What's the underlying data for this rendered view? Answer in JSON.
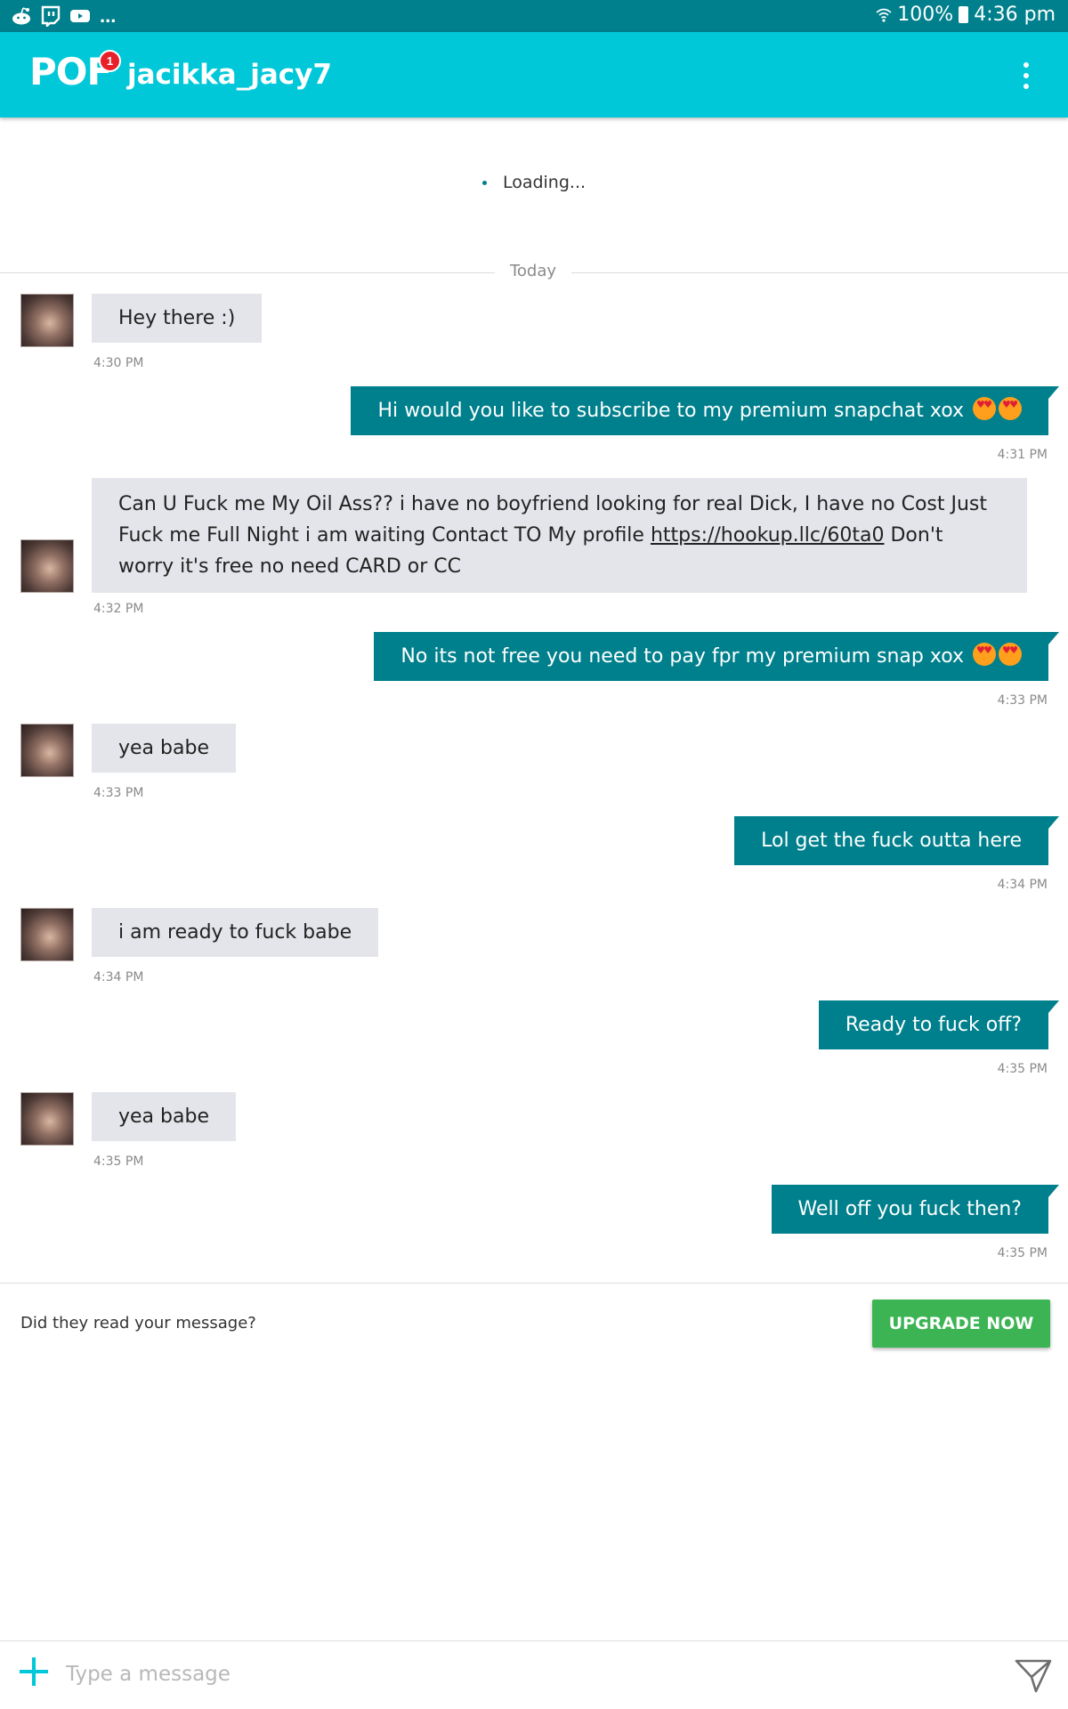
{
  "status_bar": {
    "icons": [
      "reddit-icon",
      "twitch-icon",
      "youtube-icon"
    ],
    "overflow": "...",
    "battery": "100%",
    "time": "4:36 pm"
  },
  "app_bar": {
    "logo": "POF",
    "notification_count": "1",
    "username": "jacikka_jacy7"
  },
  "loading_text": "Loading...",
  "date_divider": "Today",
  "messages": [
    {
      "direction": "in",
      "text": "Hey there :)",
      "time": "4:30 PM"
    },
    {
      "direction": "out",
      "text": "Hi would you like to subscribe to my premium snapchat xox",
      "emoji": "heart-eyes-emoji x2",
      "time": "4:31 PM"
    },
    {
      "direction": "in",
      "text_before_link": "Can U Fuck me My Oil Ass?? i have no boyfriend looking for real Dick, I have no Cost Just Fuck me Full Night i am waiting Contact TO My profile ",
      "link": "https://hookup.llc/60ta0",
      "text_after_link": " Don't worry it's free no need CARD or CC",
      "time": "4:32 PM"
    },
    {
      "direction": "out",
      "text": "No its not free you need to pay fpr my premium snap xox",
      "emoji": "heart-eyes-emoji x2",
      "time": "4:33 PM"
    },
    {
      "direction": "in",
      "text": "yea babe",
      "time": "4:33 PM"
    },
    {
      "direction": "out",
      "text": "Lol get the fuck outta here",
      "time": "4:34 PM"
    },
    {
      "direction": "in",
      "text": "i am ready to fuck babe",
      "time": "4:34 PM"
    },
    {
      "direction": "out",
      "text": "Ready to fuck off?",
      "time": "4:35 PM"
    },
    {
      "direction": "in",
      "text": "yea babe",
      "time": "4:35 PM"
    },
    {
      "direction": "out",
      "text": "Well off you fuck then?",
      "time": "4:35 PM"
    }
  ],
  "promo": {
    "question": "Did they read your message?",
    "button": "UPGRADE NOW"
  },
  "composer": {
    "placeholder": "Type a message"
  },
  "colors": {
    "status_bar": "#00808c",
    "app_bar": "#00c8d8",
    "outgoing_bubble": "#00808c",
    "incoming_bubble": "#e3e5ea",
    "upgrade_button": "#3cb453",
    "badge": "#e8202a"
  }
}
